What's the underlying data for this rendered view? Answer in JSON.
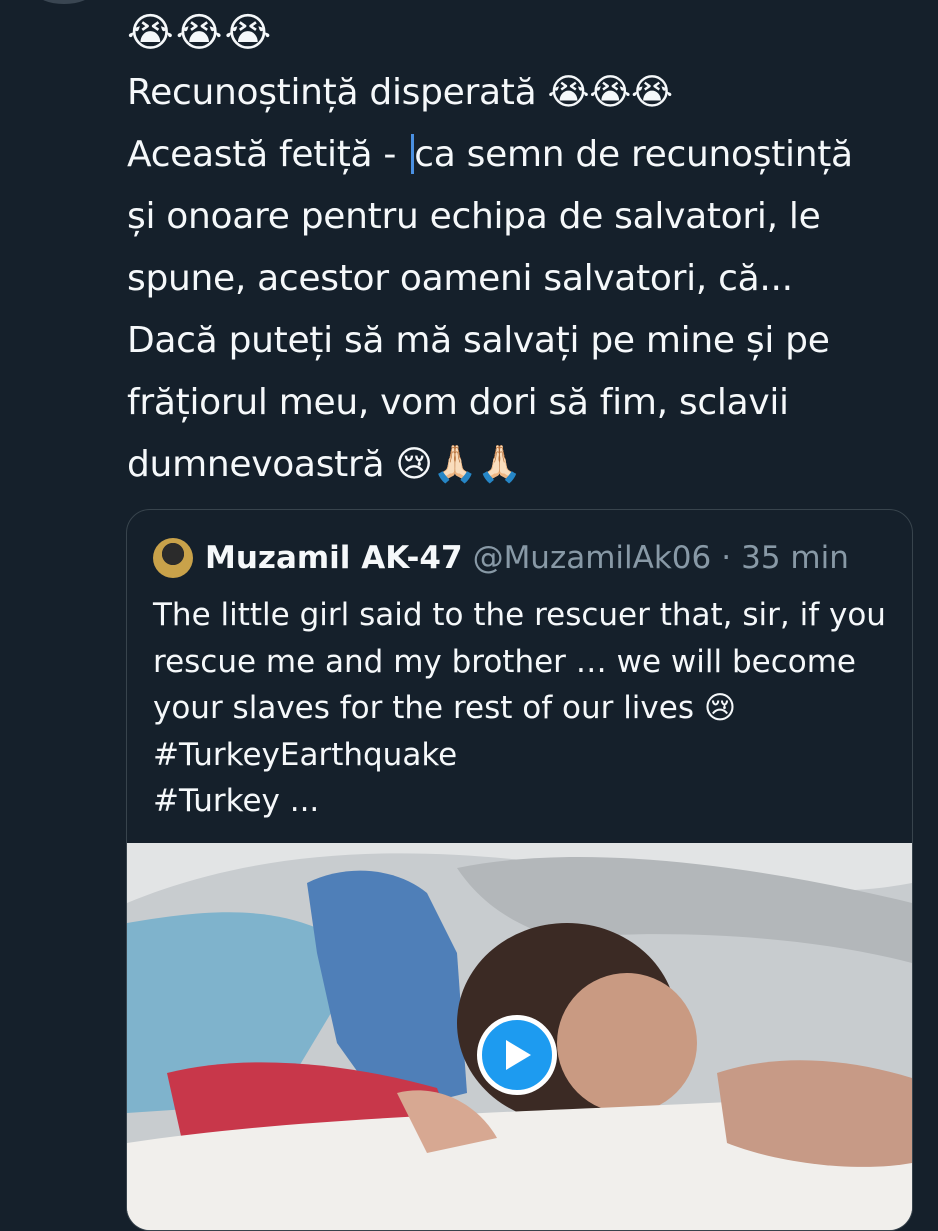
{
  "tweet": {
    "emoji_row": "😭😭😭",
    "lines": [
      "Recunoștință disperată 😭😭😭",
      "Această fetiță - ca semn de recunoștință",
      "și onoare pentru echipa de salvatori, le",
      "spune, acestor oameni salvatori, că...",
      "Dacă puteți să mă salvați pe mine și pe",
      "frățiorul meu, vom dori să fim, sclavii",
      "dumnevoastră 😢🙏🏻🙏🏻"
    ],
    "line2_before_caret": "Această fetiță - ",
    "line2_after_caret": "ca semn de recunoștință"
  },
  "quote": {
    "name": "Muzamil AK-47",
    "handle": "@MuzamilAk06",
    "separator": "·",
    "time": "35 min",
    "lines": [
      "The little girl said to the rescuer that, sir, if you",
      "rescue me and my brother … we will become",
      "your slaves for the rest of our lives 😢",
      "#TurkeyEarthquake",
      "#Turkey ..."
    ]
  },
  "icons": {
    "play": "play-icon",
    "expand": "more-icon"
  },
  "colors": {
    "background": "#15202b",
    "text": "#f5f8fa",
    "secondary": "#8899a6",
    "accent": "#1d9bf0",
    "border": "#38444d"
  }
}
